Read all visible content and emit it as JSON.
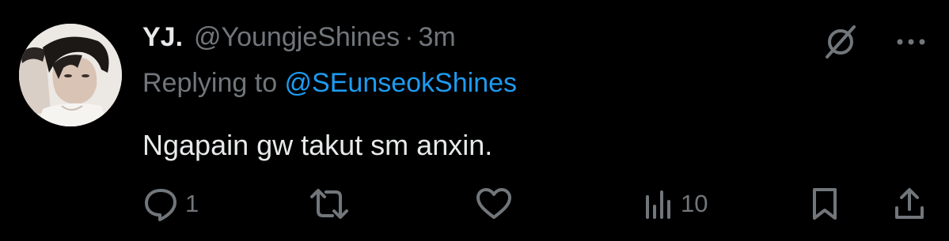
{
  "tweet": {
    "display_name": "YJ.",
    "handle": "@YoungjeShines",
    "separator": "·",
    "time": "3m",
    "reply_prefix": "Replying to ",
    "reply_to": "@SEunseokShines",
    "text": "Ngapain gw takut sm anxin."
  },
  "actions": {
    "reply_count": "1",
    "views_count": "10"
  },
  "icons": {
    "top": [
      "grok-icon",
      "more-icon"
    ],
    "bottom": [
      "reply-icon",
      "retweet-icon",
      "like-icon",
      "views-icon",
      "bookmark-icon",
      "share-icon"
    ]
  },
  "colors": {
    "background": "#000000",
    "primary_text": "#e7e9ea",
    "secondary_text": "#71767b",
    "link": "#1d9bf0"
  }
}
